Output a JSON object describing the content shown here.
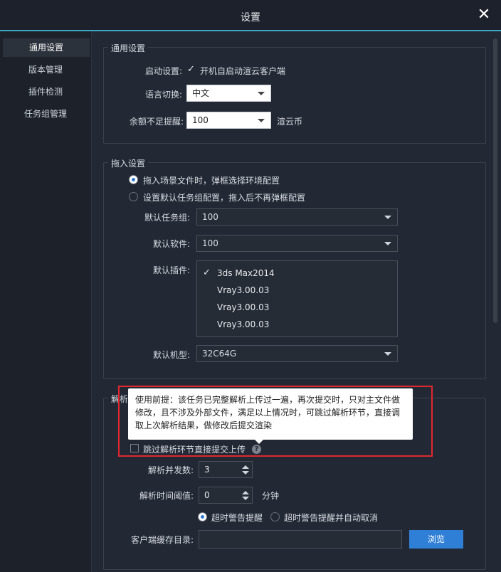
{
  "window": {
    "title": "设置",
    "close_icon": "close-icon"
  },
  "sidebar": {
    "items": [
      {
        "label": "通用设置",
        "active": true
      },
      {
        "label": "版本管理",
        "active": false
      },
      {
        "label": "插件检测",
        "active": false
      },
      {
        "label": "任务组管理",
        "active": false
      }
    ]
  },
  "general": {
    "legend": "通用设置",
    "startup_label": "启动设置:",
    "startup_checkbox_label": "开机自启动渲云客户端",
    "startup_checked": true,
    "language_label": "语言切换:",
    "language_value": "中文",
    "balance_label": "余额不足提醒:",
    "balance_value": "100",
    "balance_unit": "渲云币"
  },
  "import": {
    "legend": "拖入设置",
    "radio1": "拖入场景文件时，弹框选择环境配置",
    "radio2": "设置默认任务组配置，拖入后不再弹框配置",
    "radio1_selected": true,
    "task_group_label": "默认任务组:",
    "task_group_value": "100",
    "software_label": "默认软件:",
    "software_value": "100",
    "plugin_label": "默认插件:",
    "plugins": [
      {
        "name": "3ds Max2014",
        "checked": true
      },
      {
        "name": "Vray3.00.03"
      },
      {
        "name": "Vray3.00.03"
      },
      {
        "name": "Vray3.00.03"
      }
    ],
    "machine_label": "默认机型:",
    "machine_value": "32C64G"
  },
  "analysis": {
    "legend": "解析",
    "tooltip_line1": "使用前提：该任务已完整解析上传过一遍，再次提交时，只对主文件做",
    "tooltip_line2": "修改，且不涉及外部文件，满足以上情况时，可跳过解析环节，直接调",
    "tooltip_line3": "取上次解析结果，做修改后提交渲染",
    "skip_label": "跳过解析环节直接提交上传",
    "skip_checked": false,
    "help_icon": "?",
    "concurrency_label": "解析并发数:",
    "concurrency_value": "3",
    "timeout_label": "解析时间阈值:",
    "timeout_value": "0",
    "timeout_unit": "分钟",
    "warn_radio": "超时警告提醒",
    "warn_cancel_radio": "超时警告提醒并自动取消",
    "cache_label": "客户端缓存目录:",
    "cache_value": "",
    "browse_label": "浏览"
  },
  "colors": {
    "accent": "#3fa7c4",
    "button": "#2f7fd6",
    "highlight": "#e0282e"
  }
}
